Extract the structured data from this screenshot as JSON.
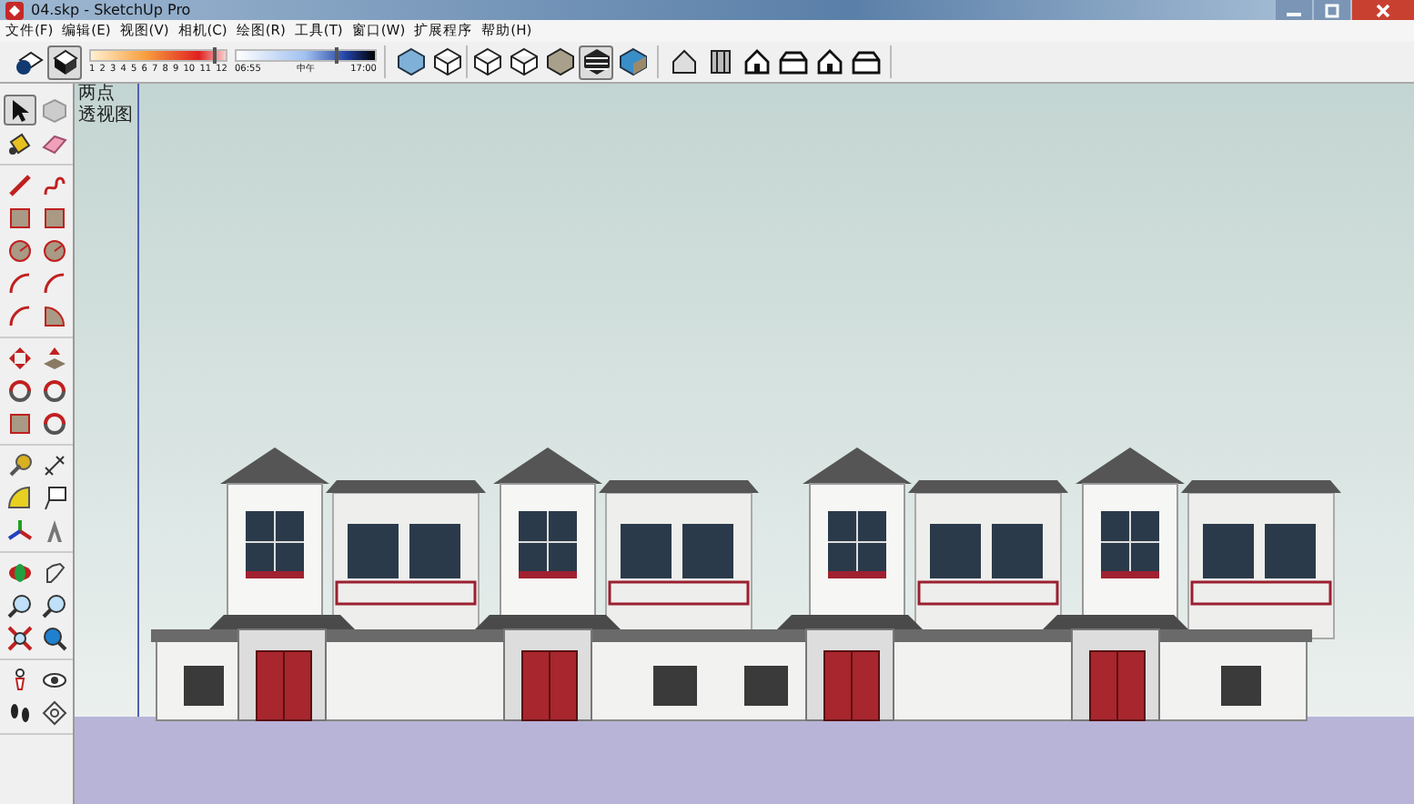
{
  "window": {
    "title": "04.skp - SketchUp Pro"
  },
  "menu": [
    "文件(F)",
    "编辑(E)",
    "视图(V)",
    "相机(C)",
    "绘图(R)",
    "工具(T)",
    "窗口(W)",
    "扩展程序",
    "帮助(H)"
  ],
  "toolbar": {
    "shadow_buttons": [
      {
        "kind": "shadow-settings",
        "selected": false
      },
      {
        "kind": "shadow-toggle",
        "selected": true
      }
    ],
    "months": [
      "1",
      "2",
      "3",
      "4",
      "5",
      "6",
      "7",
      "8",
      "9",
      "10",
      "11",
      "12"
    ],
    "time_labels": [
      "06:55",
      "中午",
      "17:00"
    ],
    "date_slider": {
      "level": 0.92
    },
    "time_slider": {
      "level": 0.73
    },
    "view_buttons": [
      {
        "kind": "xray",
        "selected": false
      },
      {
        "kind": "back-edges",
        "selected": false
      },
      {
        "kind": "wireframe",
        "selected": false
      },
      {
        "kind": "hidden-line",
        "selected": false
      },
      {
        "kind": "shaded",
        "selected": false
      },
      {
        "kind": "shaded-textures",
        "selected": true
      },
      {
        "kind": "monochrome",
        "selected": false
      }
    ],
    "camera_buttons": [
      {
        "kind": "iso"
      },
      {
        "kind": "top"
      },
      {
        "kind": "front"
      },
      {
        "kind": "right"
      },
      {
        "kind": "back"
      },
      {
        "kind": "left"
      }
    ]
  },
  "tools": [
    {
      "kind": "select",
      "selected": true
    },
    {
      "kind": "component",
      "selected": false
    },
    {
      "kind": "paint",
      "selected": false
    },
    {
      "kind": "eraser",
      "selected": false
    },
    {
      "kind": "line",
      "selected": false
    },
    {
      "kind": "freehand",
      "selected": false
    },
    {
      "kind": "rect",
      "selected": false
    },
    {
      "kind": "rotrect",
      "selected": false
    },
    {
      "kind": "circle",
      "selected": false
    },
    {
      "kind": "polygon",
      "selected": false
    },
    {
      "kind": "arc",
      "selected": false
    },
    {
      "kind": "arc2",
      "selected": false
    },
    {
      "kind": "arc3",
      "selected": false
    },
    {
      "kind": "pie",
      "selected": false
    },
    {
      "kind": "move",
      "selected": false
    },
    {
      "kind": "pushpull",
      "selected": false
    },
    {
      "kind": "rotate",
      "selected": false
    },
    {
      "kind": "followme",
      "selected": false
    },
    {
      "kind": "scale",
      "selected": false
    },
    {
      "kind": "offset",
      "selected": false
    },
    {
      "kind": "tape",
      "selected": false
    },
    {
      "kind": "dimension",
      "selected": false
    },
    {
      "kind": "protractor",
      "selected": false
    },
    {
      "kind": "text",
      "selected": false
    },
    {
      "kind": "axes",
      "selected": false
    },
    {
      "kind": "solidtext",
      "selected": false
    },
    {
      "kind": "orbit",
      "selected": false
    },
    {
      "kind": "pan",
      "selected": false
    },
    {
      "kind": "zoom",
      "selected": false
    },
    {
      "kind": "zoomwindow",
      "selected": false
    },
    {
      "kind": "zoomext",
      "selected": false
    },
    {
      "kind": "prevview",
      "selected": false
    },
    {
      "kind": "walk",
      "selected": false
    },
    {
      "kind": "lookaround",
      "selected": false
    },
    {
      "kind": "footprints",
      "selected": false
    },
    {
      "kind": "section",
      "selected": false
    }
  ],
  "viewport": {
    "labels": [
      "两点",
      "透视图"
    ]
  }
}
